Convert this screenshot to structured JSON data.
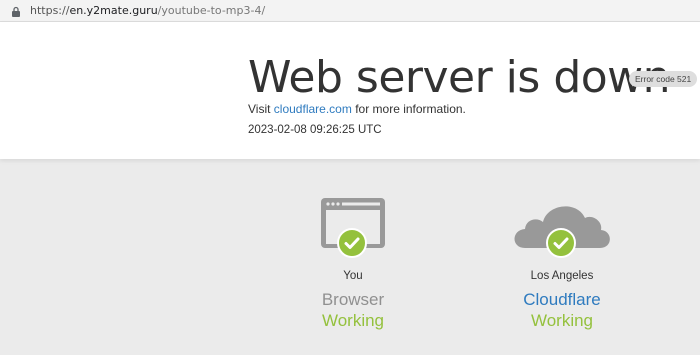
{
  "browser": {
    "url_scheme": "https://",
    "url_host": "en.y2mate.guru",
    "url_path": "/youtube-to-mp3-4/"
  },
  "error": {
    "title": "Web server is down",
    "badge": "Error code 521",
    "visit_prefix": "Visit",
    "visit_link": "cloudflare.com",
    "visit_suffix": "for more information.",
    "timestamp": "2023-02-08 09:26:25 UTC"
  },
  "nodes": [
    {
      "location": "You",
      "name": "Browser",
      "status": "Working",
      "icon": "browser-icon"
    },
    {
      "location": "Los Angeles",
      "name": "Cloudflare",
      "status": "Working",
      "icon": "cloud-icon"
    }
  ],
  "colors": {
    "ok": "#94c13d",
    "link": "#2f7bbf",
    "icon_gray": "#999999"
  }
}
